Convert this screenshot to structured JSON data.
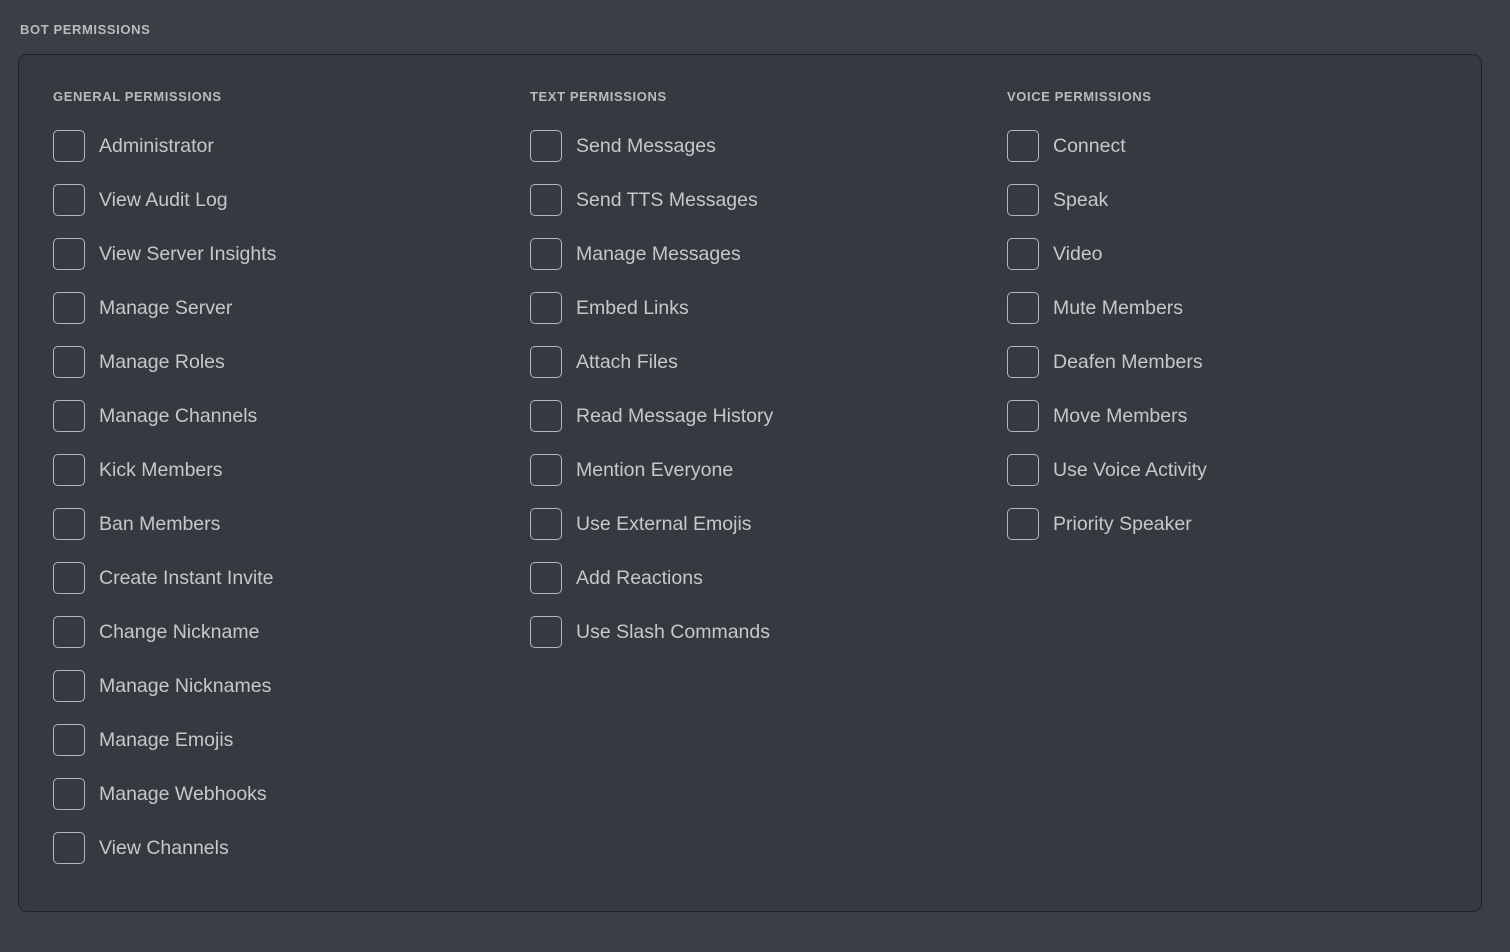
{
  "header": {
    "section_label": "BOT PERMISSIONS"
  },
  "colors": {
    "page_background": "#3b3e45",
    "card_background": "#36393f",
    "card_border": "#212327",
    "heading_text": "#b9bbbe",
    "label_text": "#c6c8cb",
    "checkbox_border": "#b2b5b9"
  },
  "columns": [
    {
      "title": "GENERAL PERMISSIONS",
      "items": [
        {
          "label": "Administrator",
          "checked": false
        },
        {
          "label": "View Audit Log",
          "checked": false
        },
        {
          "label": "View Server Insights",
          "checked": false
        },
        {
          "label": "Manage Server",
          "checked": false
        },
        {
          "label": "Manage Roles",
          "checked": false
        },
        {
          "label": "Manage Channels",
          "checked": false
        },
        {
          "label": "Kick Members",
          "checked": false
        },
        {
          "label": "Ban Members",
          "checked": false
        },
        {
          "label": "Create Instant Invite",
          "checked": false
        },
        {
          "label": "Change Nickname",
          "checked": false
        },
        {
          "label": "Manage Nicknames",
          "checked": false
        },
        {
          "label": "Manage Emojis",
          "checked": false
        },
        {
          "label": "Manage Webhooks",
          "checked": false
        },
        {
          "label": "View Channels",
          "checked": false
        }
      ]
    },
    {
      "title": "TEXT PERMISSIONS",
      "items": [
        {
          "label": "Send Messages",
          "checked": false
        },
        {
          "label": "Send TTS Messages",
          "checked": false
        },
        {
          "label": "Manage Messages",
          "checked": false
        },
        {
          "label": "Embed Links",
          "checked": false
        },
        {
          "label": "Attach Files",
          "checked": false
        },
        {
          "label": "Read Message History",
          "checked": false
        },
        {
          "label": "Mention Everyone",
          "checked": false
        },
        {
          "label": "Use External Emojis",
          "checked": false
        },
        {
          "label": "Add Reactions",
          "checked": false
        },
        {
          "label": "Use Slash Commands",
          "checked": false
        }
      ]
    },
    {
      "title": "VOICE PERMISSIONS",
      "items": [
        {
          "label": "Connect",
          "checked": false
        },
        {
          "label": "Speak",
          "checked": false
        },
        {
          "label": "Video",
          "checked": false
        },
        {
          "label": "Mute Members",
          "checked": false
        },
        {
          "label": "Deafen Members",
          "checked": false
        },
        {
          "label": "Move Members",
          "checked": false
        },
        {
          "label": "Use Voice Activity",
          "checked": false
        },
        {
          "label": "Priority Speaker",
          "checked": false
        }
      ]
    }
  ]
}
